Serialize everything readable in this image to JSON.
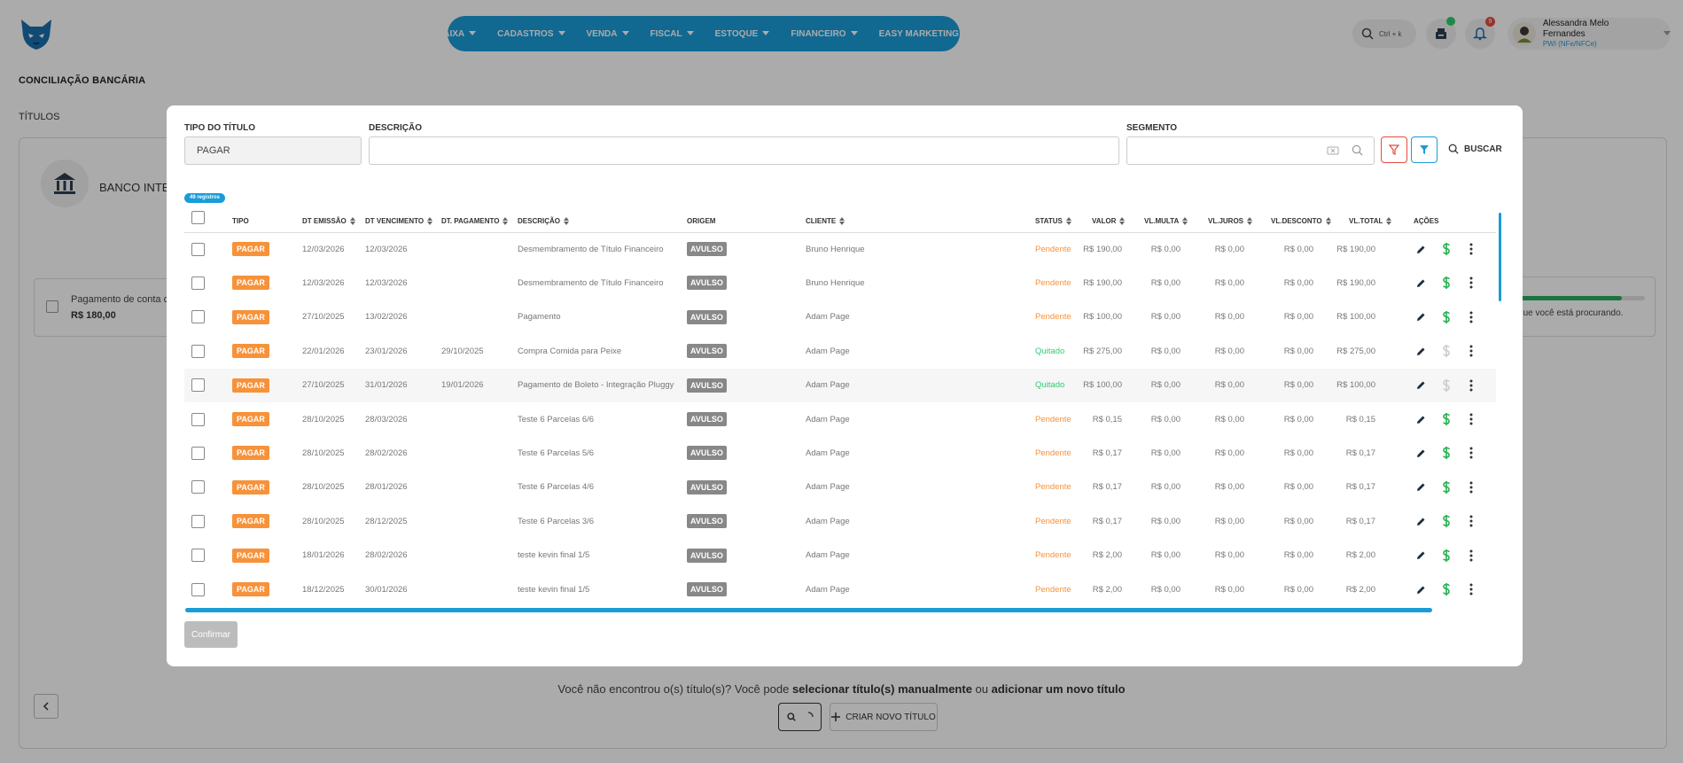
{
  "header": {
    "nav": [
      "CAIXA",
      "CADASTROS",
      "VENDA",
      "FISCAL",
      "ESTOQUE",
      "FINANCEIRO",
      "EASY MARKETING"
    ],
    "search_shortcut": "Ctrl + k",
    "notification_count": "9",
    "user_name": "Alessandra Melo Fernandes",
    "user_role": "PWI (NFe/NFCe)"
  },
  "page": {
    "title": "CONCILIAÇÃO BANCÁRIA",
    "subtitle": "TÍTULOS",
    "bank_name": "BANCO INTER",
    "payment_card_title": "Pagamento de conta c",
    "payment_card_value": "R$ 180,00",
    "right_text": "ser o que você está procurando.",
    "progress_fraction": 0.82,
    "bottom_question_prefix": "Você não encontrou o(s) título(s)? Você pode ",
    "bottom_question_link1": "selecionar título(s) manualmente",
    "bottom_question_mid": " ou ",
    "bottom_question_link2": "adicionar um novo título",
    "new_title_button": "CRIAR NOVO TÍTULO"
  },
  "modal": {
    "tipo_label": "TIPO DO TÍTULO",
    "tipo_value": "PAGAR",
    "descricao_label": "DESCRIÇÃO",
    "segmento_label": "SEGMENTO",
    "buscar_label": "BUSCAR",
    "records_badge": "49 registros",
    "confirm_label": "Confirmar",
    "columns": {
      "tipo": "TIPO",
      "dt_emissao": "DT EMISSÃO",
      "dt_vencimento": "DT VENCIMENTO",
      "dt_pagamento": "DT. PAGAMENTO",
      "descricao": "DESCRIÇÃO",
      "origem": "ORIGEM",
      "cliente": "CLIENTE",
      "status": "STATUS",
      "valor": "VALOR",
      "vl_multa": "VL.MULTA",
      "vl_juros": "VL.JUROS",
      "vl_desconto": "VL.DESCONTO",
      "vl_total": "VL.TOTAL",
      "acoes": "AÇÕES"
    },
    "rows": [
      {
        "tipo": "PAGAR",
        "emissao": "12/03/2026",
        "vencimento": "12/03/2026",
        "pagamento": "",
        "descricao": "Desmembramento de Título Financeiro",
        "origem": "AVULSO",
        "cliente": "Bruno Henrique",
        "status": "Pendente",
        "valor": "R$ 190,00",
        "multa": "R$ 0,00",
        "juros": "R$ 0,00",
        "desconto": "R$ 0,00",
        "total": "R$ 190,00"
      },
      {
        "tipo": "PAGAR",
        "emissao": "12/03/2026",
        "vencimento": "12/03/2026",
        "pagamento": "",
        "descricao": "Desmembramento de Título Financeiro",
        "origem": "AVULSO",
        "cliente": "Bruno Henrique",
        "status": "Pendente",
        "valor": "R$ 190,00",
        "multa": "R$ 0,00",
        "juros": "R$ 0,00",
        "desconto": "R$ 0,00",
        "total": "R$ 190,00"
      },
      {
        "tipo": "PAGAR",
        "emissao": "27/10/2025",
        "vencimento": "13/02/2026",
        "pagamento": "",
        "descricao": "Pagamento",
        "origem": "AVULSO",
        "cliente": "Adam Page",
        "status": "Pendente",
        "valor": "R$ 100,00",
        "multa": "R$ 0,00",
        "juros": "R$ 0,00",
        "desconto": "R$ 0,00",
        "total": "R$ 100,00"
      },
      {
        "tipo": "PAGAR",
        "emissao": "22/01/2026",
        "vencimento": "23/01/2026",
        "pagamento": "29/10/2025",
        "descricao": "Compra Comida para Peixe",
        "origem": "AVULSO",
        "cliente": "Adam Page",
        "status": "Quitado",
        "valor": "R$ 275,00",
        "multa": "R$ 0,00",
        "juros": "R$ 0,00",
        "desconto": "R$ 0,00",
        "total": "R$ 275,00"
      },
      {
        "tipo": "PAGAR",
        "emissao": "27/10/2025",
        "vencimento": "31/01/2026",
        "pagamento": "19/01/2026",
        "descricao": "Pagamento de Boleto - Integração Pluggy",
        "origem": "AVULSO",
        "cliente": "Adam Page",
        "status": "Quitado",
        "valor": "R$ 100,00",
        "multa": "R$ 0,00",
        "juros": "R$ 0,00",
        "desconto": "R$ 0,00",
        "total": "R$ 100,00"
      },
      {
        "tipo": "PAGAR",
        "emissao": "28/10/2025",
        "vencimento": "28/03/2026",
        "pagamento": "",
        "descricao": "Teste 6 Parcelas 6/6",
        "origem": "AVULSO",
        "cliente": "Adam Page",
        "status": "Pendente",
        "valor": "R$ 0,15",
        "multa": "R$ 0,00",
        "juros": "R$ 0,00",
        "desconto": "R$ 0,00",
        "total": "R$ 0,15"
      },
      {
        "tipo": "PAGAR",
        "emissao": "28/10/2025",
        "vencimento": "28/02/2026",
        "pagamento": "",
        "descricao": "Teste 6 Parcelas 5/6",
        "origem": "AVULSO",
        "cliente": "Adam Page",
        "status": "Pendente",
        "valor": "R$ 0,17",
        "multa": "R$ 0,00",
        "juros": "R$ 0,00",
        "desconto": "R$ 0,00",
        "total": "R$ 0,17"
      },
      {
        "tipo": "PAGAR",
        "emissao": "28/10/2025",
        "vencimento": "28/01/2026",
        "pagamento": "",
        "descricao": "Teste 6 Parcelas 4/6",
        "origem": "AVULSO",
        "cliente": "Adam Page",
        "status": "Pendente",
        "valor": "R$ 0,17",
        "multa": "R$ 0,00",
        "juros": "R$ 0,00",
        "desconto": "R$ 0,00",
        "total": "R$ 0,17"
      },
      {
        "tipo": "PAGAR",
        "emissao": "28/10/2025",
        "vencimento": "28/12/2025",
        "pagamento": "",
        "descricao": "Teste 6 Parcelas 3/6",
        "origem": "AVULSO",
        "cliente": "Adam Page",
        "status": "Pendente",
        "valor": "R$ 0,17",
        "multa": "R$ 0,00",
        "juros": "R$ 0,00",
        "desconto": "R$ 0,00",
        "total": "R$ 0,17"
      },
      {
        "tipo": "PAGAR",
        "emissao": "18/01/2026",
        "vencimento": "28/02/2026",
        "pagamento": "",
        "descricao": "teste kevin final 1/5",
        "origem": "AVULSO",
        "cliente": "Adam Page",
        "status": "Pendente",
        "valor": "R$ 2,00",
        "multa": "R$ 0,00",
        "juros": "R$ 0,00",
        "desconto": "R$ 0,00",
        "total": "R$ 2,00"
      },
      {
        "tipo": "PAGAR",
        "emissao": "18/12/2025",
        "vencimento": "30/01/2026",
        "pagamento": "",
        "descricao": "teste kevin final 1/5",
        "origem": "AVULSO",
        "cliente": "Adam Page",
        "status": "Pendente",
        "valor": "R$ 2,00",
        "multa": "R$ 0,00",
        "juros": "R$ 0,00",
        "desconto": "R$ 0,00",
        "total": "R$ 2,00"
      }
    ]
  },
  "colors": {
    "accent": "#1a9cd8",
    "pagar_badge": "#f7923a",
    "avulso_badge": "#888888",
    "pendente": "#f7923a",
    "quitado": "#2ecc71",
    "dollar_active": "#22b14c",
    "dollar_disabled": "#cccccc",
    "filter_red": "#e74c3c"
  }
}
